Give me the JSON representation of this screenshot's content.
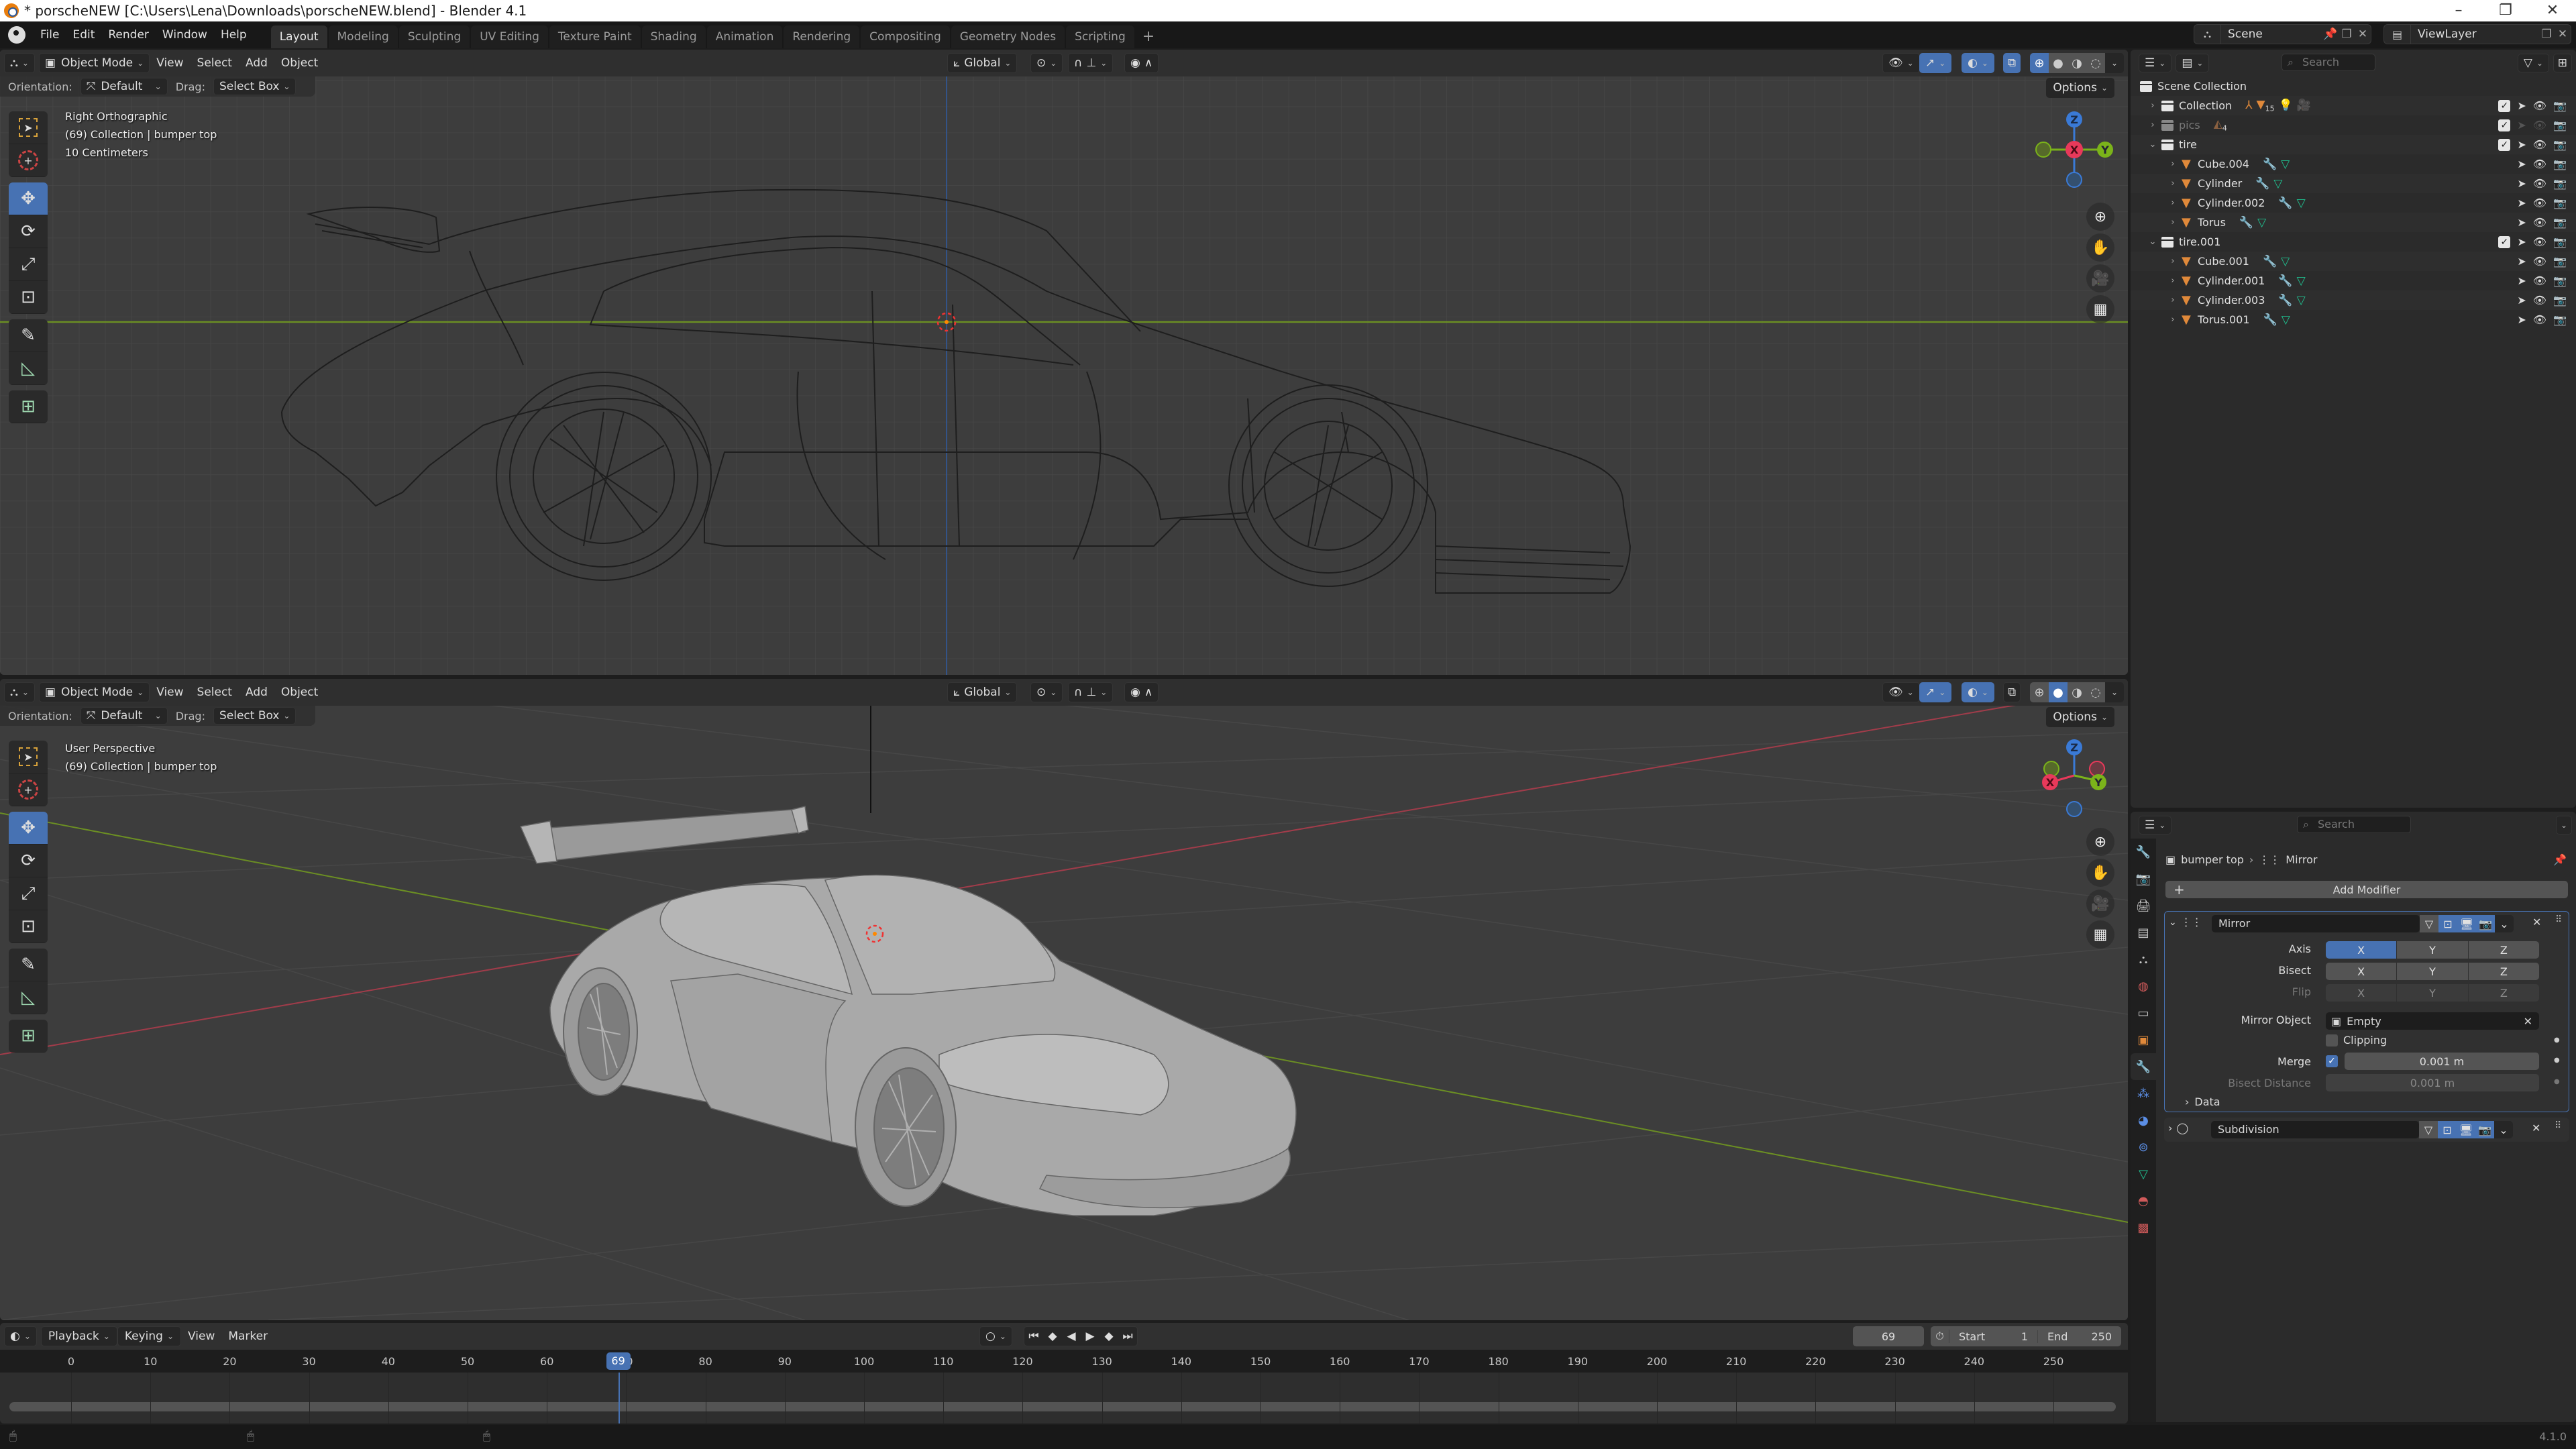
{
  "window": {
    "title": "* porscheNEW [C:\\Users\\Lena\\Downloads\\porscheNEW.blend] - Blender 4.1",
    "controls": [
      "minimize",
      "maximize",
      "close"
    ]
  },
  "menubar": {
    "items": [
      "File",
      "Edit",
      "Render",
      "Window",
      "Help"
    ],
    "workspaces": [
      "Layout",
      "Modeling",
      "Sculpting",
      "UV Editing",
      "Texture Paint",
      "Shading",
      "Animation",
      "Rendering",
      "Compositing",
      "Geometry Nodes",
      "Scripting"
    ],
    "active_workspace": "Layout",
    "add_workspace": "+",
    "scene": "Scene",
    "view_layer": "ViewLayer"
  },
  "viewport_top": {
    "mode": "Object Mode",
    "menus": [
      "View",
      "Select",
      "Add",
      "Object"
    ],
    "orientation_label": "Orientation:",
    "orientation_value": "Default",
    "drag_label": "Drag:",
    "drag_value": "Select Box",
    "transform_orientation": "Global",
    "options": "Options",
    "overlay_lines": [
      "Right Orthographic",
      "(69) Collection | bumper top",
      "10 Centimeters"
    ],
    "shading": "wireframe",
    "gizmo": {
      "center": "X",
      "top": "Z",
      "right": "Y"
    }
  },
  "viewport_bottom": {
    "mode": "Object Mode",
    "menus": [
      "View",
      "Select",
      "Add",
      "Object"
    ],
    "orientation_label": "Orientation:",
    "orientation_value": "Default",
    "drag_label": "Drag:",
    "drag_value": "Select Box",
    "transform_orientation": "Global",
    "options": "Options",
    "overlay_lines": [
      "User Perspective",
      "(69) Collection | bumper top"
    ],
    "shading": "solid",
    "gizmo": {
      "x": "X",
      "y": "Y",
      "z": "Z"
    }
  },
  "toolbar_tools": [
    "select-box",
    "cursor",
    "move",
    "rotate",
    "scale",
    "transform",
    "annotate",
    "measure",
    "add-cube"
  ],
  "outliner": {
    "search_placeholder": "Search",
    "root": "Scene Collection",
    "rows": [
      {
        "name": "Collection",
        "type": "collection",
        "depth": 1,
        "expanded": false,
        "badge": "15",
        "checked": true,
        "dim": false
      },
      {
        "name": "pics",
        "type": "collection",
        "depth": 1,
        "expanded": false,
        "badge": "4",
        "checked": true,
        "dim": true
      },
      {
        "name": "tire",
        "type": "collection",
        "depth": 1,
        "expanded": true,
        "checked": true,
        "dim": false
      },
      {
        "name": "Cube.004",
        "type": "mesh",
        "depth": 2
      },
      {
        "name": "Cylinder",
        "type": "mesh",
        "depth": 2
      },
      {
        "name": "Cylinder.002",
        "type": "mesh",
        "depth": 2
      },
      {
        "name": "Torus",
        "type": "mesh",
        "depth": 2
      },
      {
        "name": "tire.001",
        "type": "collection",
        "depth": 1,
        "expanded": true,
        "checked": true,
        "dim": false
      },
      {
        "name": "Cube.001",
        "type": "mesh",
        "depth": 2
      },
      {
        "name": "Cylinder.001",
        "type": "mesh",
        "depth": 2
      },
      {
        "name": "Cylinder.003",
        "type": "mesh",
        "depth": 2
      },
      {
        "name": "Torus.001",
        "type": "mesh",
        "depth": 2
      }
    ]
  },
  "properties": {
    "search_placeholder": "Search",
    "breadcrumb_object": "bumper top",
    "breadcrumb_modifier": "Mirror",
    "add_modifier": "Add Modifier",
    "modifiers": [
      {
        "name": "Mirror",
        "expanded": true,
        "axis_label": "Axis",
        "bisect_label": "Bisect",
        "flip_label": "Flip",
        "xyz": [
          "X",
          "Y",
          "Z"
        ],
        "axis_active": "X",
        "mirror_object_label": "Mirror Object",
        "mirror_object_value": "Empty",
        "clipping_label": "Clipping",
        "clipping": false,
        "merge_label": "Merge",
        "merge_enabled": true,
        "merge_value": "0.001 m",
        "bisect_distance_label": "Bisect Distance",
        "bisect_distance_value": "0.001 m",
        "data_label": "Data"
      },
      {
        "name": "Subdivision",
        "expanded": false
      }
    ],
    "tabs": [
      "tool",
      "render",
      "output",
      "view-layer",
      "scene",
      "world",
      "collection",
      "object",
      "modifiers",
      "particles",
      "physics",
      "constraints",
      "data",
      "material",
      "texture"
    ],
    "active_tab": "modifiers"
  },
  "timeline": {
    "menus": [
      "Playback",
      "Keying",
      "View",
      "Marker"
    ],
    "current_frame": "69",
    "start_label": "Start",
    "start_value": "1",
    "end_label": "End",
    "end_value": "250",
    "ticks": [
      "0",
      "10",
      "20",
      "30",
      "40",
      "50",
      "60",
      "70",
      "80",
      "90",
      "100",
      "110",
      "120",
      "130",
      "140",
      "150",
      "160",
      "170",
      "180",
      "190",
      "200",
      "210",
      "220",
      "230",
      "240",
      "250"
    ]
  },
  "statusbar": {
    "version": "4.1.0"
  }
}
